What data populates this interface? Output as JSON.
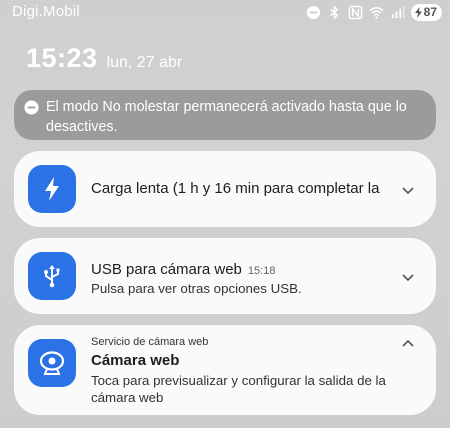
{
  "status_bar": {
    "carrier": "Digi.Mobil",
    "battery_level": "87"
  },
  "lockscreen": {
    "time": "15:23",
    "date": "lun, 27 abr"
  },
  "dnd_banner": {
    "text": "El modo No molestar permanecerá activado hasta que lo desactives."
  },
  "notifications": {
    "charge": {
      "title": "Carga lenta (1 h y 16 min para completar la..."
    },
    "usb": {
      "title": "USB para cámara web",
      "time": "15:18",
      "subtitle": "Pulsa para ver otras opciones USB."
    },
    "webcam": {
      "app_label": "Servicio de cámara web",
      "title": "Cámara web",
      "subtitle": "Toca para previsualizar y configurar la salida de la cámara web"
    }
  },
  "colors": {
    "accent": "#2a72e6",
    "card_bg": "#fafafa",
    "banner_bg": "#9b9b9b",
    "backdrop": "#cfcfcf"
  },
  "icons": {
    "status": [
      "dnd-icon",
      "bluetooth-icon",
      "nfc-icon",
      "wifi-icon",
      "signal-icon",
      "battery-icon"
    ],
    "charge": "lightning-bolt-icon",
    "usb": "usb-icon",
    "webcam": "webcam-icon",
    "expand": "chevron-down-icon",
    "collapse": "chevron-up-icon"
  }
}
